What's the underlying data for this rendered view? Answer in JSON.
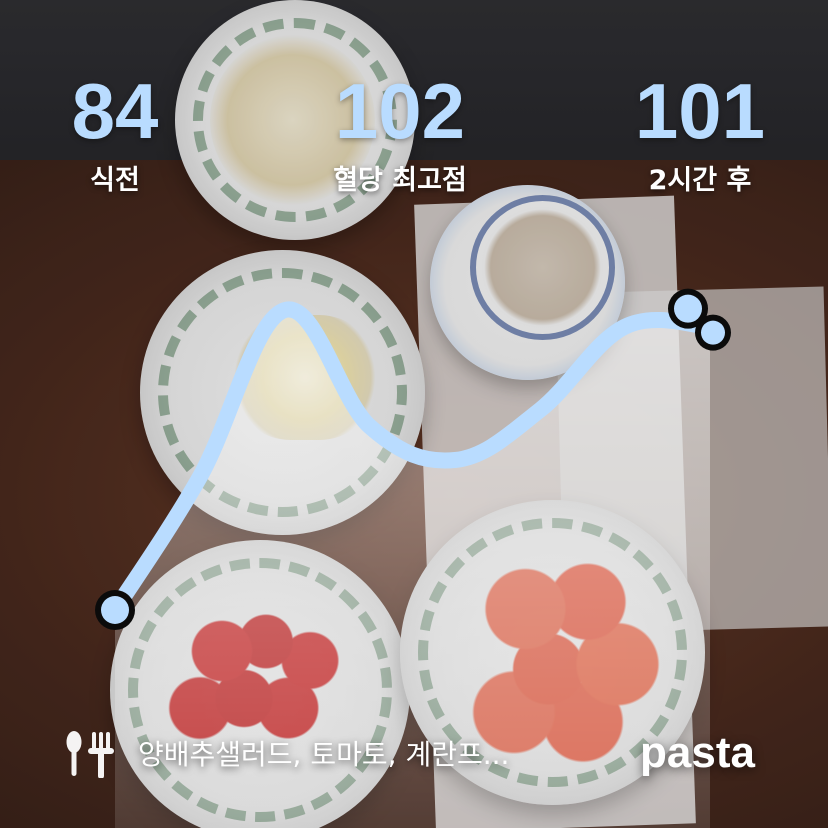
{
  "stats": {
    "before_meal": {
      "value": "84",
      "label": "식전"
    },
    "peak": {
      "value": "102",
      "label": "혈당 최고점"
    },
    "after_2h": {
      "value": "101",
      "label": "2시간 후"
    }
  },
  "chart_data": {
    "type": "line",
    "series": [
      {
        "values": [
          84,
          92,
          102,
          95,
          93,
          96,
          101,
          101
        ]
      }
    ]
  },
  "meal": {
    "icon": "fork-spoon-icon",
    "text": "양배추샐러드, 토마토, 계란프..."
  },
  "brand": {
    "name": "pasta"
  },
  "colors": {
    "accent": "#b9dcff",
    "text": "#ffffff"
  }
}
